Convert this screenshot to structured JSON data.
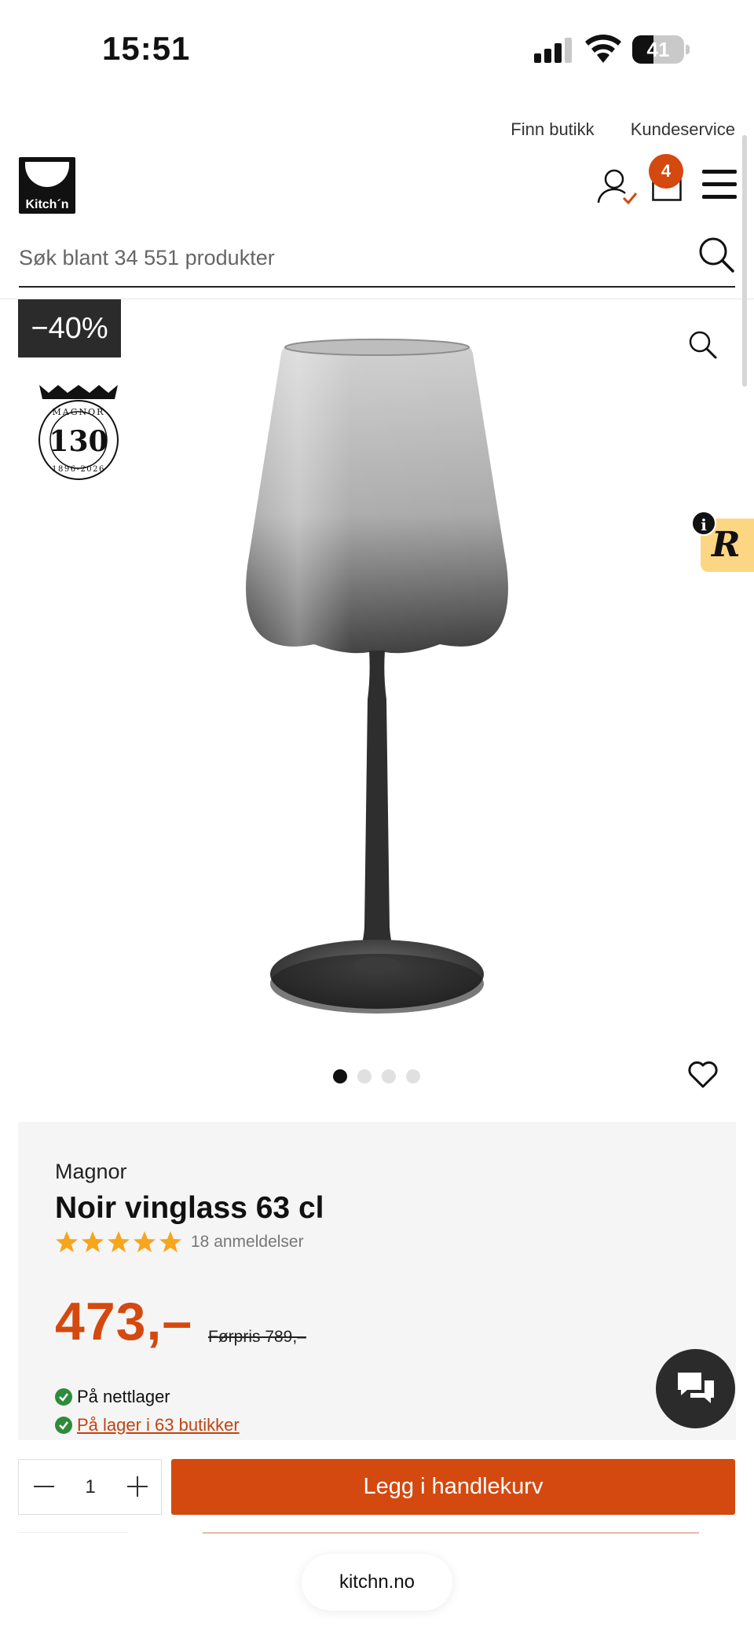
{
  "status_bar": {
    "time": "15:51",
    "battery": "41",
    "battery_level": 0.41
  },
  "header": {
    "links": [
      "Finn butikk",
      "Kundeservice"
    ],
    "logo_text": "Kitch´n",
    "cart_count": "4"
  },
  "search": {
    "placeholder": "Søk blant 34 551 produkter"
  },
  "product": {
    "discount": "−40%",
    "brand": "Magnor",
    "title": "Noir vinglass 63 cl",
    "rating": 5,
    "reviews": "18 anmeldelser",
    "price": "473,–",
    "old_price": "Førpris 789,–",
    "stock_online": "På nettlager",
    "stock_stores": " På lager i 63 butikker",
    "seal_text_top": "MAGNOR",
    "seal_number": "130",
    "seal_text_bottom": "1896-2026"
  },
  "carousel": {
    "count": 4,
    "active": 0
  },
  "cart_bar": {
    "quantity": "1",
    "add_label": "Legg i handlekurv"
  },
  "browser": {
    "url": "kitchn.no"
  },
  "colors": {
    "accent": "#d4490f",
    "badge_bg": "#2b2b2b",
    "panel_bg": "#f5f5f5",
    "star": "#f7a51c",
    "stock_green": "#2e8b3a"
  },
  "icons": [
    "signal-icon",
    "wifi-icon",
    "battery-icon",
    "user-icon",
    "cart-icon",
    "menu-icon",
    "search-icon",
    "zoom-icon",
    "heart-icon",
    "star-icon",
    "check-icon",
    "chat-icon"
  ]
}
